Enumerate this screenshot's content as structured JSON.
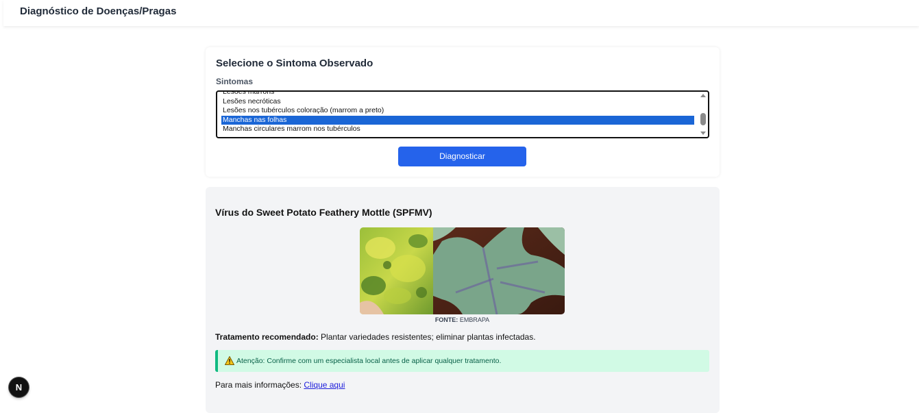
{
  "header": {
    "title": "Diagnóstico de Doenças/Pragas"
  },
  "symptom_form": {
    "heading": "Selecione o Sintoma Observado",
    "label": "Sintomas",
    "options": [
      "Lesões marrons",
      "Lesões necróticas",
      "Lesões nos tubérculos coloração (marrom a preto)",
      "Manchas nas folhas",
      "Manchas circulares marrom nos tubérculos"
    ],
    "selected": "Manchas nas folhas",
    "button_label": "Diagnosticar"
  },
  "result": {
    "disease_name": "Vírus do Sweet Potato Feathery Mottle (SPFMV)",
    "image_caption_label": "FONTE:",
    "image_caption_source": "EMBRAPA",
    "treatment_label": "Tratamento recomendado:",
    "treatment_text": "Plantar variedades resistentes; eliminar plantas infectadas.",
    "alert_text": "Atenção: Confirme com um especialista local antes de aplicar qualquer tratamento.",
    "more_info_label": "Para mais informações:",
    "more_info_link": "Clique aqui"
  },
  "dev_badge": {
    "letter": "N"
  },
  "colors": {
    "accent": "#2563eb",
    "selected_option": "#1a66d6",
    "alert_bg": "#d1fae5",
    "alert_border": "#10b981"
  }
}
